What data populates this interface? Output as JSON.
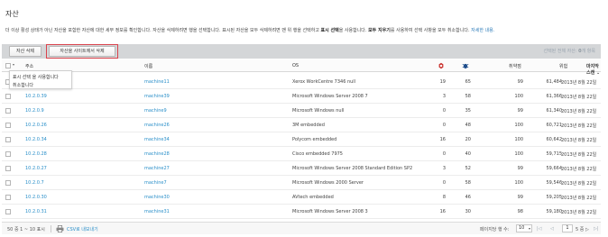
{
  "page": {
    "title": "자산",
    "description_plain": "더 이상 활성 상태가 아닌 자산을 포함한 자산에 대한 세부 정보를 확인합니다. 자산을 삭제하려면 행을 선택합니다. 표시된 자산을 모두 삭제하려면 맨 위 행을 선택하고 ",
    "description_bold1": "표시 선택",
    "description_mid": "을 사용합니다. ",
    "description_bold2": "모두 지우기",
    "description_end": "를 사용하여 선택 사항을 모두 취소합니다. ",
    "description_link": "자세한 내용."
  },
  "toolbar": {
    "delete_asset_label": "자산 삭제",
    "delete_from_site_label": "자산을 사이트에서 삭제",
    "selected_prefix": "선택된 전체 자산: ",
    "selected_count": "0",
    "selected_suffix": "개 항목",
    "highlight_color": "#d9434c"
  },
  "select_menu": {
    "item_select_shown": "표시 선택 을 사용합니다",
    "item_cancel": "취소합니다"
  },
  "table": {
    "columns": {
      "address": "주소",
      "name": "이름",
      "os": "OS",
      "exploits_icon": "exploit-icon",
      "malware_icon": "malware-icon",
      "vulnerabilities": "취약점",
      "risk": "위험",
      "last_scan": "마지막 스캔"
    },
    "sort_indicator": "⌄",
    "rows": [
      {
        "address": "",
        "name": "machine11",
        "os": "Xerox WorkCentre 7346 null",
        "exploits": "19",
        "malware": "65",
        "vulns": "99",
        "risk": "61,484",
        "scan": "2013년 8월 22일"
      },
      {
        "address": "10.2.0.39",
        "name": "machine39",
        "os": "Microsoft Windows Server 2008 7",
        "exploits": "3",
        "malware": "58",
        "vulns": "100",
        "risk": "61,366",
        "scan": "2013년 8월 22일"
      },
      {
        "address": "10.2.0.9",
        "name": "machine9",
        "os": "Microsoft Windows null",
        "exploits": "0",
        "malware": "35",
        "vulns": "99",
        "risk": "61,340",
        "scan": "2013년 8월 22일"
      },
      {
        "address": "10.2.0.26",
        "name": "machine26",
        "os": "3M embedded",
        "exploits": "0",
        "malware": "48",
        "vulns": "100",
        "risk": "60,721",
        "scan": "2013년 8월 22일"
      },
      {
        "address": "10.2.0.34",
        "name": "machine34",
        "os": "Polycom embedded",
        "exploits": "16",
        "malware": "20",
        "vulns": "100",
        "risk": "60,642",
        "scan": "2013년 8월 22일"
      },
      {
        "address": "10.2.0.28",
        "name": "machine28",
        "os": "Cisco embedded 7975",
        "exploits": "0",
        "malware": "40",
        "vulns": "100",
        "risk": "59,715",
        "scan": "2013년 8월 22일"
      },
      {
        "address": "10.2.0.27",
        "name": "machine27",
        "os": "Microsoft Windows Server 2008 Standard Edition SP2",
        "exploits": "3",
        "malware": "52",
        "vulns": "99",
        "risk": "59,664",
        "scan": "2013년 8월 22일"
      },
      {
        "address": "10.2.0.7",
        "name": "machine7",
        "os": "Microsoft Windows 2000 Server",
        "exploits": "0",
        "malware": "58",
        "vulns": "100",
        "risk": "59,546",
        "scan": "2013년 8월 22일"
      },
      {
        "address": "10.2.0.30",
        "name": "machine30",
        "os": "AVtech embedded",
        "exploits": "8",
        "malware": "46",
        "vulns": "99",
        "risk": "59,205",
        "scan": "2013년 8월 22일"
      },
      {
        "address": "10.2.0.31",
        "name": "machine31",
        "os": "Microsoft Windows Server 2008 3",
        "exploits": "16",
        "malware": "30",
        "vulns": "98",
        "risk": "59,180",
        "scan": "2013년 8월 22일"
      }
    ]
  },
  "footer": {
    "showing": "50 중 1 ~ 10 표시",
    "csv_label": "CSV로 내보내기",
    "rows_per_page_label": "페이지당 행 수:",
    "rows_per_page": "10",
    "first": "|◁",
    "prev": "◁",
    "page": "1",
    "of_pages": "5 중 ▷",
    "last": "▷|"
  }
}
